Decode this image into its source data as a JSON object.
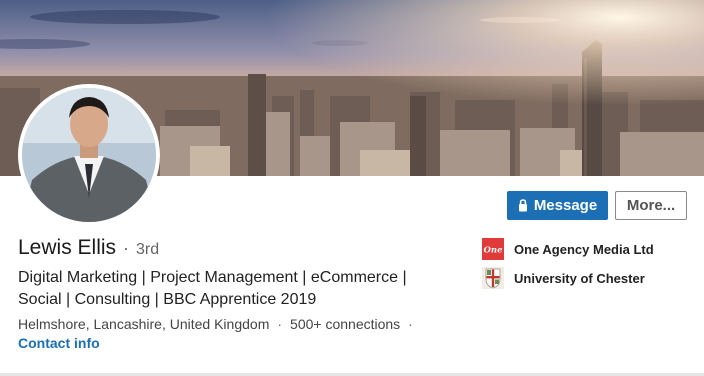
{
  "profile": {
    "name": "Lewis Ellis",
    "separator": "·",
    "degree": "3rd",
    "headline_line1": "Digital Marketing | Project Management | eCommerce |",
    "headline_line2": "Social | Consulting | BBC Apprentice 2019",
    "location": "Helmshore, Lancashire, United Kingdom",
    "connections": "500+ connections",
    "contact_label": "Contact info"
  },
  "actions": {
    "message_label": "Message",
    "more_label": "More..."
  },
  "orgs": [
    {
      "name": "One Agency Media Ltd",
      "logo_text": "One",
      "logo_color": "#e03a3a",
      "icon": "company-logo-icon"
    },
    {
      "name": "University of Chester",
      "icon": "university-crest-icon"
    }
  ],
  "colors": {
    "primary_blue": "#1c6fb5",
    "text_dark": "#222222",
    "text_muted": "#666666"
  },
  "icons": {
    "message_button": "lock-icon"
  }
}
